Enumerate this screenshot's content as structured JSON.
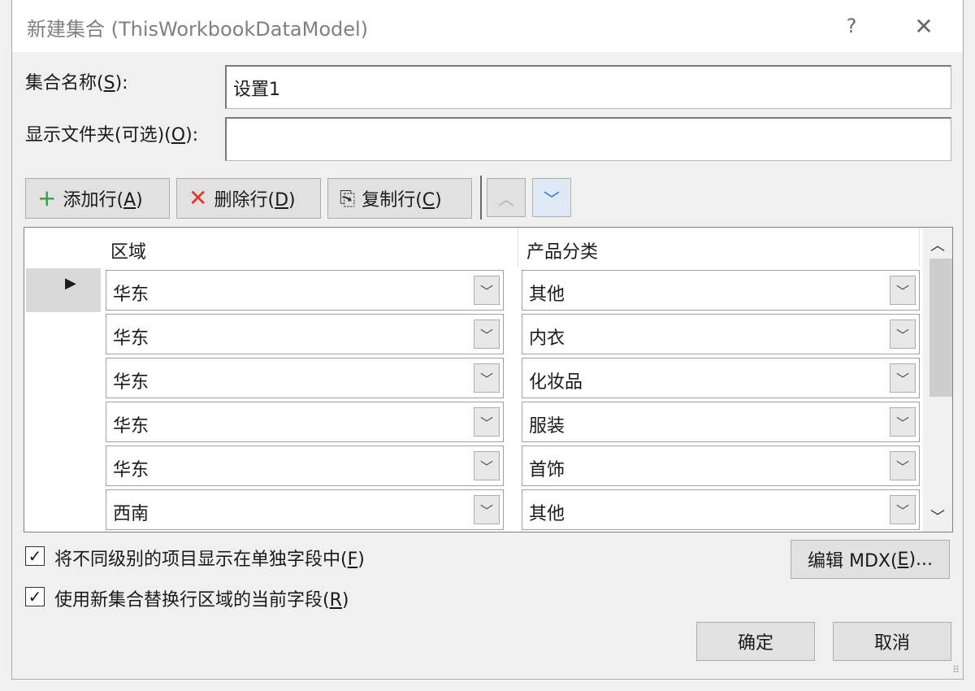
{
  "window": {
    "title": "新建集合 (ThisWorkbookDataModel)",
    "help_label": "?",
    "close_label": "✕"
  },
  "form": {
    "name_label": "集合名称(",
    "name_key": "S",
    "name_end": "):",
    "name_value": "设置1",
    "folder_label": "显示文件夹(可选)(",
    "folder_key": "O",
    "folder_end": "):",
    "folder_value": ""
  },
  "toolbar": {
    "add": {
      "icon": "plus-icon",
      "glyph": "+",
      "label": "添加行(",
      "key": "A",
      "end": ")"
    },
    "delete": {
      "icon": "x-icon",
      "glyph": "✕",
      "label": "删除行(",
      "key": "D",
      "end": ")"
    },
    "copy": {
      "icon": "copy-icon",
      "glyph": "⎘",
      "label": "复制行(",
      "key": "C",
      "end": ")"
    },
    "up_glyph": "︿",
    "down_glyph": "﹀"
  },
  "grid": {
    "columns": [
      "区域",
      "产品分类"
    ],
    "selected_marker": "▶",
    "rows": [
      {
        "region": "华东",
        "category": "其他"
      },
      {
        "region": "华东",
        "category": "内衣"
      },
      {
        "region": "华东",
        "category": "化妆品"
      },
      {
        "region": "华东",
        "category": "服装"
      },
      {
        "region": "华东",
        "category": "首饰"
      },
      {
        "region": "西南",
        "category": "其他"
      }
    ],
    "dropdown_glyph": "﹀",
    "scroll_up_glyph": "︿",
    "scroll_down_glyph": "﹀"
  },
  "options": {
    "separate_levels": {
      "checked": true,
      "label": "将不同级别的项目显示在单独字段中(",
      "key": "F",
      "end": ")"
    },
    "replace_fields": {
      "checked": true,
      "label": "使用新集合替换行区域的当前字段(",
      "key": "R",
      "end": ")"
    },
    "check_glyph": "✓"
  },
  "buttons": {
    "mdx_label": "编辑 MDX(",
    "mdx_key": "E",
    "mdx_end": ")...",
    "ok": "确定",
    "cancel": "取消"
  }
}
